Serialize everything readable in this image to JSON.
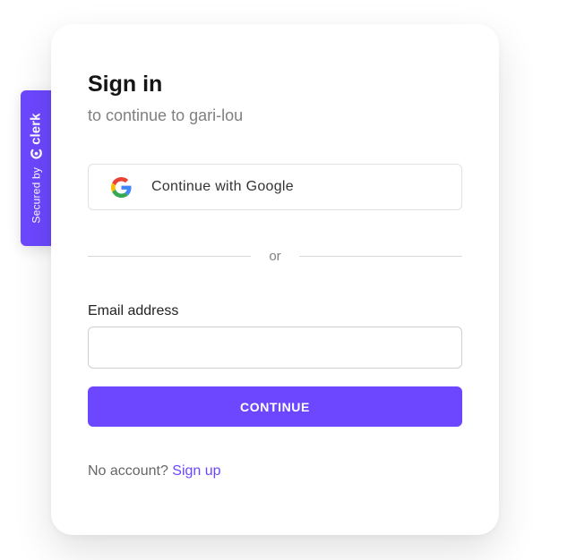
{
  "badge": {
    "secured_by": "Secured by",
    "brand": "clerk",
    "logo_icon": "clerk-logo-icon"
  },
  "signin": {
    "title": "Sign in",
    "subtitle": "to continue to gari-lou",
    "google_button": "Continue with Google",
    "google_icon": "google-icon",
    "divider": "or",
    "email_label": "Email address",
    "email_value": "",
    "continue_button": "CONTINUE",
    "no_account": "No account?",
    "signup_link": "Sign up"
  },
  "colors": {
    "accent": "#6c47ff",
    "title": "#151515",
    "muted": "#808080",
    "border": "#e2e2e2"
  }
}
